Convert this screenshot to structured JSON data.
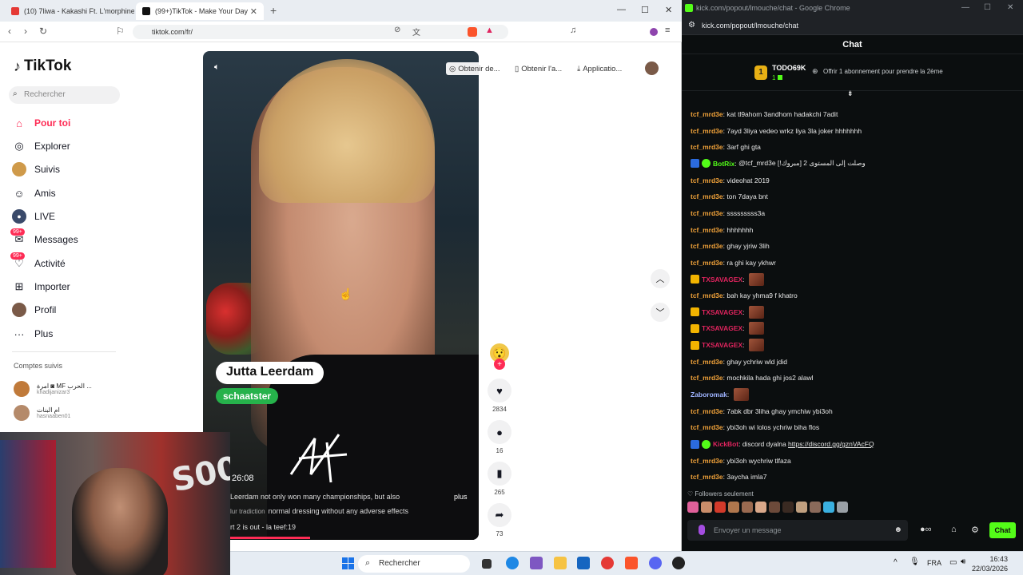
{
  "left_browser": {
    "tabs": [
      {
        "label": "(10) 7liwa - Kakashi Ft. L'morphine -"
      },
      {
        "label": "(99+)TikTok - Make Your Day"
      }
    ],
    "url": "tiktok.com/fr/"
  },
  "tiktok": {
    "logo": "TikTok",
    "search_placeholder": "Rechercher",
    "nav": [
      {
        "label": "Pour toi",
        "icon": "home-icon"
      },
      {
        "label": "Explorer",
        "icon": "compass-icon"
      },
      {
        "label": "Suivis",
        "icon": "avatar-icon"
      },
      {
        "label": "Amis",
        "icon": "friends-icon"
      },
      {
        "label": "LIVE",
        "icon": "live-icon"
      },
      {
        "label": "Messages",
        "icon": "messages-icon",
        "badge": "99+"
      },
      {
        "label": "Activité",
        "icon": "activity-icon",
        "badge": "99+"
      },
      {
        "label": "Importer",
        "icon": "upload-icon"
      },
      {
        "label": "Profil",
        "icon": "profile-icon"
      },
      {
        "label": "Plus",
        "icon": "more-icon"
      }
    ],
    "followed_heading": "Comptes suivis",
    "followed": [
      {
        "name": "امرة ◙ MF الحرب ...",
        "handle": "khadijanizar3"
      },
      {
        "name": "ام البنات",
        "handle": "hasnaaben01"
      }
    ],
    "top_buttons": [
      "Obtenir de...",
      "Obtenir l'a...",
      "Applicatio..."
    ],
    "video": {
      "name_tag": "Jutta Leerdam",
      "role_tag": "schaatster",
      "time": "26:08",
      "caption_1": "Leerdam not only won many championships, but also",
      "caption_2": "normal dressing without any adverse effects",
      "caption_2_prefix": "lur tradiction",
      "caption_3": "rt 2 is out - la teef:19",
      "more": "plus"
    },
    "actions": [
      {
        "icon": "heart-icon",
        "count": "2834"
      },
      {
        "icon": "comment-icon",
        "count": "16"
      },
      {
        "icon": "bookmark-icon",
        "count": "265"
      },
      {
        "icon": "share-icon",
        "count": "73"
      }
    ]
  },
  "chat_window": {
    "title": "kick.com/popout/lmouche/chat - Google Chrome",
    "url": "kick.com/popout/lmouche/chat",
    "header": "Chat",
    "pinned": {
      "coin": "1",
      "user": "TODO69K",
      "sub": "1",
      "text": "Offrir 1 abonnement pour prendre la 2ème"
    },
    "messages": [
      {
        "user": "tcf_mrd3e",
        "text": "kat tl9ahom 3andhom hadakchi 7adit",
        "color": "#f2a33a"
      },
      {
        "user": "tcf_mrd3e",
        "text": "7ayd 3liya vedeo wrkz liya 3la joker hhhhhhh",
        "color": "#f2a33a"
      },
      {
        "user": "tcf_mrd3e",
        "text": "3arf ghi gta",
        "color": "#f2a33a"
      },
      {
        "user": "BotRix",
        "text": "@tcf_mrd3e وصلت إلى المستوى 2 [مبروك!]",
        "color": "#53fc18",
        "bot": true
      },
      {
        "user": "tcf_mrd3e",
        "text": "videohat 2019",
        "color": "#f2a33a"
      },
      {
        "user": "tcf_mrd3e",
        "text": "ton 7daya bnt",
        "color": "#f2a33a"
      },
      {
        "user": "tcf_mrd3e",
        "text": "sssssssss3a",
        "color": "#f2a33a"
      },
      {
        "user": "tcf_mrd3e",
        "text": "hhhhhhh",
        "color": "#f2a33a"
      },
      {
        "user": "tcf_mrd3e",
        "text": "ghay yjriw 3lih",
        "color": "#f2a33a"
      },
      {
        "user": "tcf_mrd3e",
        "text": "ra ghi kay ykhwr",
        "color": "#f2a33a"
      },
      {
        "user": "TXSAVAGEX",
        "text": "",
        "color": "#e0245e",
        "crown": true,
        "emote": true
      },
      {
        "user": "tcf_mrd3e",
        "text": "bah kay yhma9 f khatro",
        "color": "#f2a33a"
      },
      {
        "user": "TXSAVAGEX",
        "text": "",
        "color": "#e0245e",
        "crown": true,
        "emote": true
      },
      {
        "user": "TXSAVAGEX",
        "text": "",
        "color": "#e0245e",
        "crown": true,
        "emote": true
      },
      {
        "user": "TXSAVAGEX",
        "text": "",
        "color": "#e0245e",
        "crown": true,
        "emote": true
      },
      {
        "user": "tcf_mrd3e",
        "text": "ghay ychriw wld jdid",
        "color": "#f2a33a"
      },
      {
        "user": "tcf_mrd3e",
        "text": "mochkila hada ghi jos2 alawl",
        "color": "#f2a33a"
      },
      {
        "user": "Zaboromak",
        "text": "",
        "color": "#9fb4ff",
        "emote": true
      },
      {
        "user": "tcf_mrd3e",
        "text": "7abk dbr 3liha ghay ymchiw ybi3oh",
        "color": "#f2a33a"
      },
      {
        "user": "tcf_mrd3e",
        "text": "ybi3oh wi lolos ychriw biha flos",
        "color": "#f2a33a"
      },
      {
        "user": "KickBot",
        "text": "discord dyalna ",
        "link": "https://discord.gg/gznVAcFQ",
        "color": "#e0245e",
        "bot": true
      },
      {
        "user": "tcf_mrd3e",
        "text": "ybi3oh wychriw tlfaza",
        "color": "#f2a33a"
      },
      {
        "user": "tcf_mrd3e",
        "text": "3aycha imla7",
        "color": "#f2a33a"
      }
    ],
    "followers_only": "Followers seulement",
    "input_placeholder": "Envoyer un message",
    "send_label": "Chat"
  },
  "taskbar": {
    "search": "Rechercher",
    "lang": "FRA",
    "time": "16:43",
    "date": "22/03/2026"
  }
}
